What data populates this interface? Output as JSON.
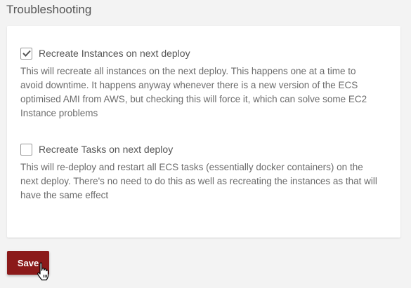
{
  "section": {
    "title": "Troubleshooting"
  },
  "options": [
    {
      "label": "Recreate Instances on next deploy",
      "checked": true,
      "description": "This will recreate all instances on the next deploy. This happens one at a time to avoid downtime. It happens anyway whenever there is a new version of the ECS optimised AMI from AWS, but checking this will force it, which can solve some EC2 Instance problems"
    },
    {
      "label": "Recreate Tasks on next deploy",
      "checked": false,
      "description": "This will re-deploy and restart all ECS tasks (essentially docker containers) on the next deploy. There's no need to do this as well as recreating the instances as that will have the same effect"
    }
  ],
  "actions": {
    "save_label": "Save"
  },
  "colors": {
    "accent": "#8b1a1a",
    "background": "#f3f3f3",
    "card": "#ffffff"
  },
  "icons": {
    "checkmark": "check-icon",
    "cursor": "hand-pointer-icon"
  }
}
